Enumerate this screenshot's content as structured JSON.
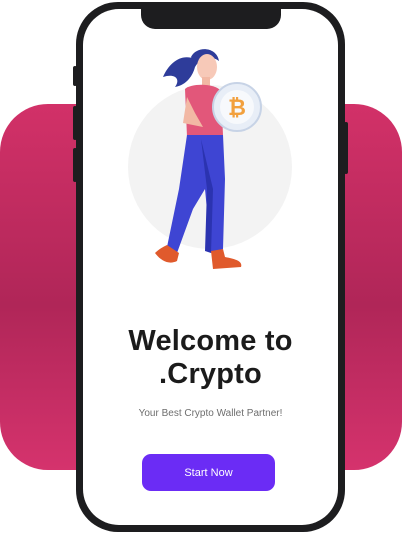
{
  "welcome": {
    "title_line1": "Welcome to",
    "title_line2": ".Crypto",
    "subtitle": "Your Best Crypto Wallet Partner!",
    "cta_label": "Start Now"
  },
  "illustration": {
    "icon": "bitcoin-coin-icon",
    "coin_symbol": "₿"
  },
  "colors": {
    "backdrop": "#c92c62",
    "phone_frame": "#1d1d1f",
    "cta_background": "#6b2cf5",
    "title_text": "#1b1b1b",
    "coin_accent": "#f2a03d"
  }
}
